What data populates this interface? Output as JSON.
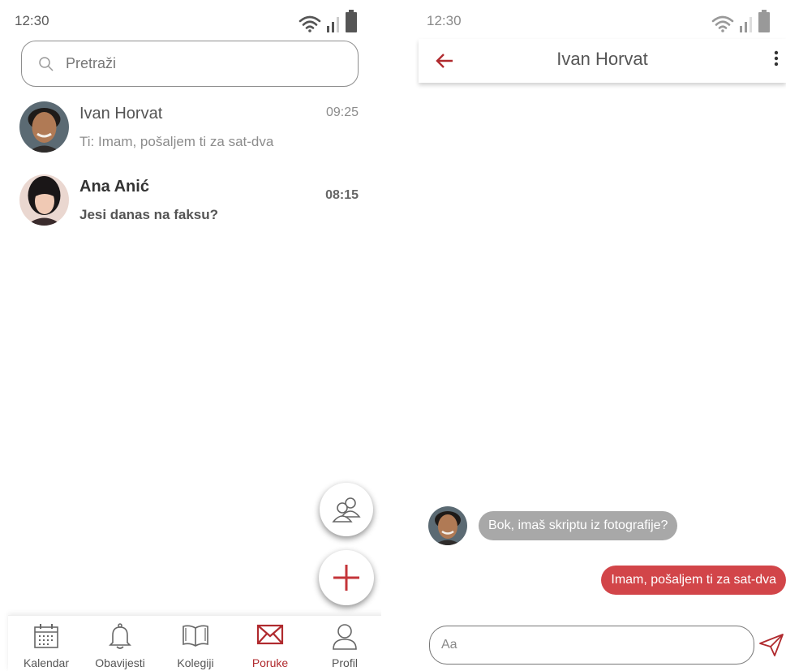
{
  "conversations_screen": {
    "status": {
      "time": "12:30"
    },
    "search": {
      "placeholder": "Pretraži"
    },
    "conversations": [
      {
        "name": "Ivan Horvat",
        "preview": "Ti: Imam, pošaljem ti za sat-dva",
        "time": "09:25",
        "unread": false
      },
      {
        "name": "Ana Anić",
        "preview": "Jesi danas na faksu?",
        "time": "08:15",
        "unread": true
      }
    ],
    "nav": [
      {
        "label": "Kalendar",
        "icon": "calendar-icon",
        "active": false
      },
      {
        "label": "Obavijesti",
        "icon": "bell-icon",
        "active": false
      },
      {
        "label": "Kolegiji",
        "icon": "book-icon",
        "active": false
      },
      {
        "label": "Poruke",
        "icon": "envelope-icon",
        "active": true
      },
      {
        "label": "Profil",
        "icon": "user-icon",
        "active": false
      }
    ]
  },
  "chat_screen": {
    "status": {
      "time": "12:30"
    },
    "title": "Ivan Horvat",
    "messages": [
      {
        "direction": "incoming",
        "text": "Bok, imaš skriptu iz fotografije?"
      },
      {
        "direction": "outgoing",
        "text": "Imam, pošaljem ti za sat-dva"
      }
    ],
    "composer": {
      "placeholder": "Aa"
    }
  },
  "colors": {
    "accent": "#b02a2e",
    "outgoing_bubble": "#d24549",
    "incoming_bubble": "#a8a8a8",
    "text_muted": "#8c8c8c"
  }
}
